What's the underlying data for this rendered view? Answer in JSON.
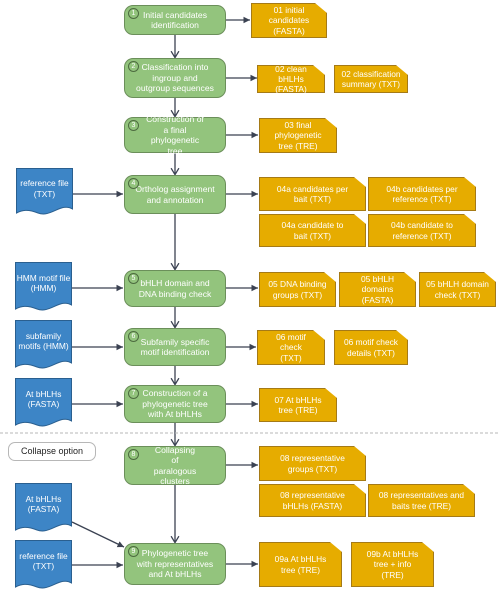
{
  "colors": {
    "process_fill": "#93c47d",
    "process_border": "#6b8f5a",
    "output_fill": "#e6ac00",
    "output_border": "#a57a16",
    "input_fill": "#3d85c6",
    "input_border": "#2a5f8f",
    "arrow": "#3b4252",
    "dashed_separator": "#b7b7b7"
  },
  "steps": [
    {
      "number": "1",
      "label": "Initial candidates identification"
    },
    {
      "number": "2",
      "label": "Classification into ingroup and outgroup sequences"
    },
    {
      "number": "3",
      "label": "Construction of a final phylogenetic tree"
    },
    {
      "number": "4",
      "label": "Ortholog assignment and annotation"
    },
    {
      "number": "5",
      "label": "bHLH domain and DNA binding check"
    },
    {
      "number": "6",
      "label": "Subfamily specific motif identification"
    },
    {
      "number": "7",
      "label": "Construction of a phylogenetic tree with At bHLHs"
    },
    {
      "number": "8",
      "label": "Collapsing of paralogous clusters"
    },
    {
      "number": "9",
      "label": "Phylogenetic tree with representatives and At bHLHs"
    }
  ],
  "outputs": {
    "step1": [
      "01 initial candidates (FASTA)"
    ],
    "step2": [
      "02 clean bHLHs (FASTA)",
      "02 classification summary (TXT)"
    ],
    "step3": [
      "03 final phylogenetic tree (TRE)"
    ],
    "step4": [
      "04a candidates per bait (TXT)",
      "04b candidates per reference (TXT)",
      "04a candidate to bait (TXT)",
      "04b candidate to reference (TXT)"
    ],
    "step5": [
      "05 DNA binding groups (TXT)",
      "05 bHLH domains (FASTA)",
      "05 bHLH domain check (TXT)"
    ],
    "step6": [
      "06 motif check (TXT)",
      "06 motif check details (TXT)"
    ],
    "step7": [
      "07 At bHLHs tree (TRE)"
    ],
    "step8": [
      "08 representative groups (TXT)",
      "08 representative bHLHs (FASTA)",
      "08 representatives and baits tree (TRE)"
    ],
    "step9": [
      "09a At bHLHs tree (TRE)",
      "09b At bHLHs tree + info (TRE)"
    ]
  },
  "inputs": [
    {
      "label": "reference file (TXT)",
      "target_step": "4"
    },
    {
      "label": "HMM motif file (HMM)",
      "target_step": "5"
    },
    {
      "label": "subfamily motifs (HMM)",
      "target_step": "6"
    },
    {
      "label": "At bHLHs (FASTA)",
      "target_step": "7"
    },
    {
      "label": "At bHLHs (FASTA)",
      "target_step": "9"
    },
    {
      "label": "reference file (TXT)",
      "target_step": "9"
    }
  ],
  "collapse_option_label": "Collapse option"
}
